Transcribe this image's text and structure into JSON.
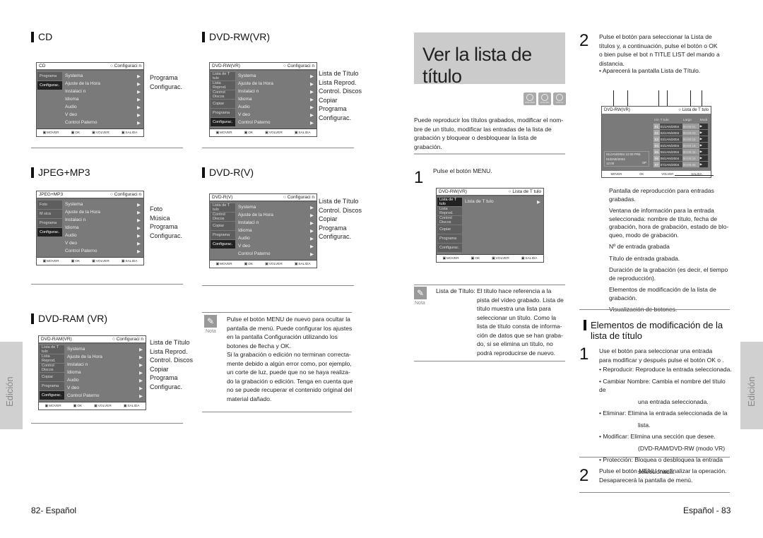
{
  "left_page": {
    "sections": [
      {
        "heading": "CD",
        "osd": {
          "disc": "CD",
          "mode": "○ Configuraci   n",
          "left": [
            "Programa",
            "Configurac."
          ],
          "left_selected": 1,
          "items": [
            "Systema",
            "Ajuste de la Hora",
            "Instalaci   n",
            "Idioma",
            "Audio",
            "V deo",
            "Control Paterno"
          ],
          "bottom": [
            "MOVER",
            "OK",
            "VOLVER",
            "SALIDA"
          ]
        },
        "list": [
          "Programa",
          "Configurac."
        ]
      },
      {
        "heading": "DVD-RW(VR)",
        "osd": {
          "disc": "DVD-RW(VR)",
          "mode": "○ Configuraci   n",
          "left": [
            "Lista de T  tulo",
            "Lista Reprod.",
            "Control Discos",
            "Copiar",
            "Programa",
            "Configurac."
          ],
          "left_selected": 5,
          "items": [
            "Systema",
            "Ajuste de la Hora",
            "Instalaci   n",
            "Idioma",
            "Audio",
            "V deo",
            "Control Paterno"
          ],
          "bottom": [
            "MOVER",
            "OK",
            "VOLVER",
            "SALIDA"
          ]
        },
        "list": [
          "Lista de Título",
          "Lista Reprod.",
          "Control. Discos",
          "Copiar",
          "Programa",
          "Configurac."
        ]
      },
      {
        "heading": "JPEG+MP3",
        "osd": {
          "disc": "JPEG+MP3",
          "mode": "○ Configuraci   n",
          "left": [
            "Foto",
            "M  sica",
            "Programa",
            "Configurac."
          ],
          "left_selected": 3,
          "items": [
            "Systema",
            "Ajuste de la Hora",
            "Instalaci   n",
            "Idioma",
            "Audio",
            "V deo",
            "Control Paterno"
          ],
          "bottom": [
            "MOVER",
            "OK",
            "VOLVER",
            "SALIDA"
          ]
        },
        "list": [
          "Foto",
          "Música",
          "Programa",
          "Configurac."
        ]
      },
      {
        "heading": "DVD-R(V)",
        "osd": {
          "disc": "DVD-R(V)",
          "mode": "○ Configuraci   n",
          "left": [
            "Lista de T  tulo",
            "Control Discos",
            "Copiar",
            "Programa",
            "Configurac."
          ],
          "left_selected": 4,
          "items": [
            "Systema",
            "Ajuste de la Hora",
            "Instalaci   n",
            "Idioma",
            "Audio",
            "V deo",
            "Control Paterno"
          ],
          "bottom": [
            "MOVER",
            "OK",
            "VOLVER",
            "SALIDA"
          ]
        },
        "list": [
          "Lista de Título",
          "Control. Discos",
          "Copiar",
          "Programa",
          "Configurac."
        ]
      },
      {
        "heading": "DVD-RAM (VR)",
        "osd": {
          "disc": "DVD-RAM(VR)",
          "mode": "○ Configuraci   n",
          "left": [
            "Lista de T  tulo",
            "Lista Reprod.",
            "Control Discos",
            "Copiar",
            "Programa",
            "Configurac."
          ],
          "left_selected": 5,
          "items": [
            "Systema",
            "Ajuste de la Hora",
            "Instalaci   n",
            "Idioma",
            "Audio",
            "V deo",
            "Control Paterno"
          ],
          "bottom": [
            "MOVER",
            "OK",
            "VOLVER",
            "SALIDA"
          ]
        },
        "list": [
          "Lista de Título",
          "Lista Reprod.",
          "Control. Discos",
          "Copiar",
          "Programa",
          "Configurac."
        ]
      }
    ],
    "note": {
      "label": "Nota",
      "lines": [
        "Pulse el botón MENU de nuevo para ocultar la",
        "pantalla de menú. Puede configurar los ajustes",
        "en la pantalla Configuración utilizando los",
        "botones de flecha y OK.",
        "Si la grabación o edición no terminan correcta-",
        "mente debido a algún error como, por ejemplo,",
        "un corte de luz, puede que no se haya realiza-",
        "do la grabación o edición. Tenga en cuenta que",
        "no se puede recuperar el contenido original del",
        "material dañado."
      ]
    },
    "side_tab": "Edición",
    "footer": "82- Español"
  },
  "right_page": {
    "title": "Ver la lista de título",
    "disc_badges": [
      "DVD-RAM",
      "DVD-RW",
      "DVD-R"
    ],
    "intro": [
      "Puede reproducir los títulos grabados, modificar el nom-",
      "bre de un título, modificar las entradas de la lista de",
      "grabación y bloquear o desbloquear la lista de",
      "grabación."
    ],
    "step1": {
      "num": "1",
      "text": "Pulse el botón MENU.",
      "osd": {
        "disc": "DVD-RW(VR)",
        "mode": "○ Lista de T  tulo",
        "left": [
          "Lista de T  tulo",
          "Lista Reprod.",
          "Control Discos",
          "Copiar",
          "Programa",
          "Configurac."
        ],
        "left_selected": 0,
        "items": [
          "Lista de T  tulo"
        ],
        "bottom": [
          "MOVER",
          "OK",
          "VOLVER",
          "SALIDA"
        ]
      }
    },
    "note": {
      "label": "Nota",
      "term": "Lista de Título:",
      "lines": [
        "El título hace referencia a la",
        "pista del vídeo grabado. Lista de",
        "título muestra una lista para",
        "seleccionar un título. Como la",
        "lista de título consta de informa-",
        "ción de datos que se han graba-",
        "do, si se elimina un título, no",
        "podrá reproducirse de nuevo."
      ]
    },
    "step2": {
      "num": "2",
      "lines": [
        "Pulse el botón          para seleccionar la Lista de",
        "títulos y, a continuación, pulse el botón      o OK",
        "o bien pulse el bot     n TITLE LIST del mando a",
        "distancia."
      ],
      "bullet": "• Aparecerá la pantalla Lista de Título."
    },
    "title_list_screen": {
      "disc": "DVD-RW(VR)",
      "mode": "○ Lista de T  tulo",
      "columns": [
        "n/o",
        "T  tulo",
        "Largo",
        "Modi"
      ],
      "rows": [
        {
          "no": "01",
          "title": "01/JAN/2004",
          "length": "00:00:01"
        },
        {
          "no": "02",
          "title": "02/JAN/2004",
          "length": "00:00:03"
        },
        {
          "no": "03",
          "title": "03/JAN/2004",
          "length": "00:00:15"
        },
        {
          "no": "04",
          "title": "04/JAN/2004",
          "length": "00:00:18"
        },
        {
          "no": "05",
          "title": "05/JAN/2004",
          "length": "00:05:32"
        },
        {
          "no": "06",
          "title": "06/JAN/2004",
          "length": "00:05:15"
        },
        {
          "no": "07",
          "title": "07/JAN/2004",
          "length": "00:09:26"
        }
      ],
      "info": [
        "01/JAN/2004 12:00  PR5",
        "01/ENE/2004",
        "12:00"
      ],
      "info_mode": "SP",
      "bottom": [
        "MOVER",
        "OK",
        "VOLVER",
        "SALIDA"
      ]
    },
    "legend": [
      "Pantalla de reproducción para entradas grabadas.",
      "Ventana de información para la entrada seleccionada: nombre de título, fecha de grabación, hora de grabación, estado de blo-queo, modo de grabación.",
      "Nº de entrada grabada",
      "Título de entrada grabada.",
      "Duración de la grabación (es decir, el tiempo de reproducción).",
      "Elementos de modificación de la lista de grabación.",
      "Visualización de botones."
    ],
    "mod_section": {
      "heading_line1": "Elementos de modificación de la",
      "heading_line2": "lista de título",
      "step1_num": "1",
      "step1_lines": [
        "Use el botón          para seleccionar una entrada",
        "para modificar y después pulse el botón OK o      ."
      ],
      "bullets": [
        [
          "• Reproducir: Reproduce la entrada seleccionada."
        ],
        [
          "• Cambiar Nombre: Cambia el nombre del título de",
          "una entrada seleccionada."
        ],
        [
          "• Eliminar: Elimina la entrada seleccionada de la",
          "lista."
        ],
        [
          "• Modificar: Elimina una sección que desee.",
          "(DVD-RAM/DVD-RW (modo VR)"
        ],
        [
          "• Protección: Bloquea o desbloquea la entrada",
          "seleccionada."
        ]
      ],
      "step2_num": "2",
      "step2_lines": [
        "Pulse el botón MENU tras finalizar la operación.",
        "Desaparecerá la pantalla de menú."
      ]
    },
    "side_tab": "Edición",
    "footer": "Español - 83"
  }
}
